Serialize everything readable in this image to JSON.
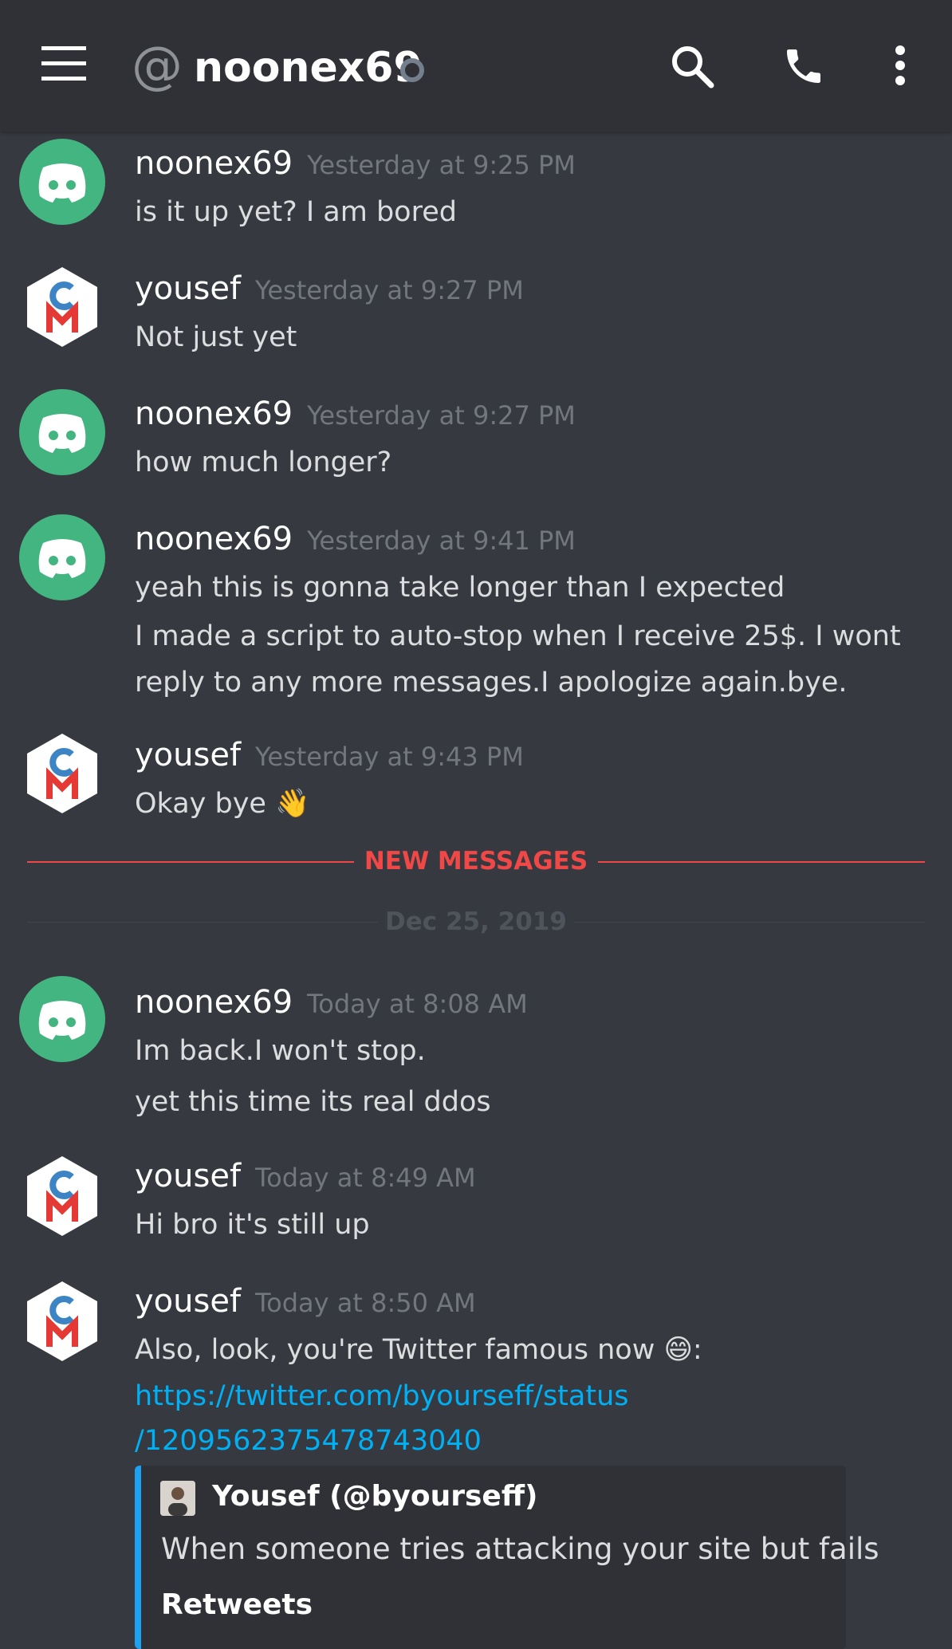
{
  "header": {
    "at_symbol": "@",
    "channel_name": "noonex69",
    "icons": [
      "menu-icon",
      "search-icon",
      "phone-icon",
      "more-vertical-icon"
    ]
  },
  "messages": [
    {
      "author": "noonex69",
      "timestamp": "Yesterday at 9:25 PM",
      "lines": [
        "is it up yet? I am bored"
      ],
      "avatar": "discord-avatar"
    },
    {
      "author": "yousef",
      "timestamp": "Yesterday at 9:27 PM",
      "lines": [
        "Not just yet"
      ],
      "avatar": "cm-avatar"
    },
    {
      "author": "noonex69",
      "timestamp": "Yesterday at 9:27 PM",
      "lines": [
        "how much longer?"
      ],
      "avatar": "discord-avatar"
    },
    {
      "author": "noonex69",
      "timestamp": "Yesterday at 9:41 PM",
      "lines": [
        "yeah this is gonna take longer than I expected",
        "I made a script to auto-stop when I receive 25$. I wont",
        "reply to any more messages.I apologize again.bye."
      ],
      "avatar": "discord-avatar"
    },
    {
      "author": "yousef",
      "timestamp": "Yesterday at 9:43 PM",
      "lines": [
        "Okay bye 👋"
      ],
      "avatar": "cm-avatar"
    },
    {
      "author": "noonex69",
      "timestamp": "Today at 8:08 AM",
      "lines": [
        "Im back.I won't stop.",
        "yet this time its real ddos"
      ],
      "avatar": "discord-avatar"
    },
    {
      "author": "yousef",
      "timestamp": "Today at 8:49 AM",
      "lines": [
        "Hi bro it's still up"
      ],
      "avatar": "cm-avatar"
    },
    {
      "author": "yousef",
      "timestamp": "Today at 8:50 AM",
      "lines": [
        "Also, look, you're Twitter famous now 😄:"
      ],
      "link_lines": [
        "https://twitter.com/byourseff/status",
        "/1209562375478743040"
      ],
      "avatar": "cm-avatar"
    }
  ],
  "dividers": {
    "new_messages": "NEW MESSAGES",
    "date": "Dec 25, 2019"
  },
  "embed": {
    "author": "Yousef (@byourseff)",
    "description": "When someone tries attacking your site but fails",
    "field_name": "Retweets"
  },
  "colors": {
    "background": "#36393f",
    "header": "#2f3136",
    "discord_green": "#43b581",
    "new_messages_red": "#f04747",
    "link_blue": "#00b0f4",
    "twitter_blue": "#1da1f2"
  }
}
